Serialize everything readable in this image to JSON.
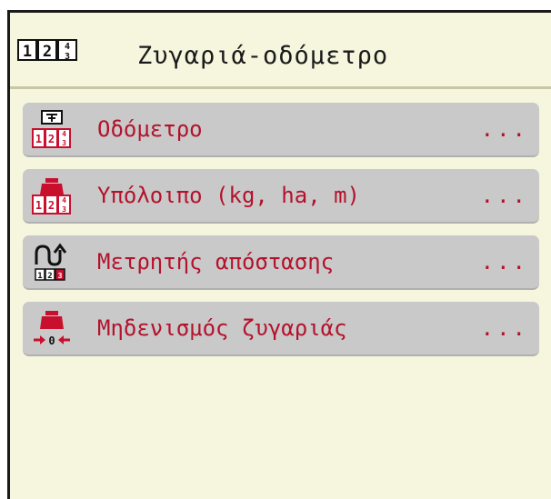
{
  "header": {
    "icon": "counter-123-icon",
    "title": "Ζυγαριά-οδόμετρο"
  },
  "menu": {
    "items": [
      {
        "label": "Οδόμετρο",
        "suffix": "...",
        "icon": "odometer-icon"
      },
      {
        "label": "Υπόλοιπο (kg, ha, m)",
        "suffix": "...",
        "icon": "remaining-weight-icon"
      },
      {
        "label": "Μετρητής απόστασης",
        "suffix": "...",
        "icon": "distance-counter-icon"
      },
      {
        "label": "Μηδενισμός ζυγαριάς",
        "suffix": "...",
        "icon": "scale-zero-icon"
      }
    ]
  },
  "colors": {
    "background": "#f6f5dd",
    "item_bg": "#c9c9c9",
    "label": "#b3122c",
    "icon_red": "#c8102e"
  }
}
